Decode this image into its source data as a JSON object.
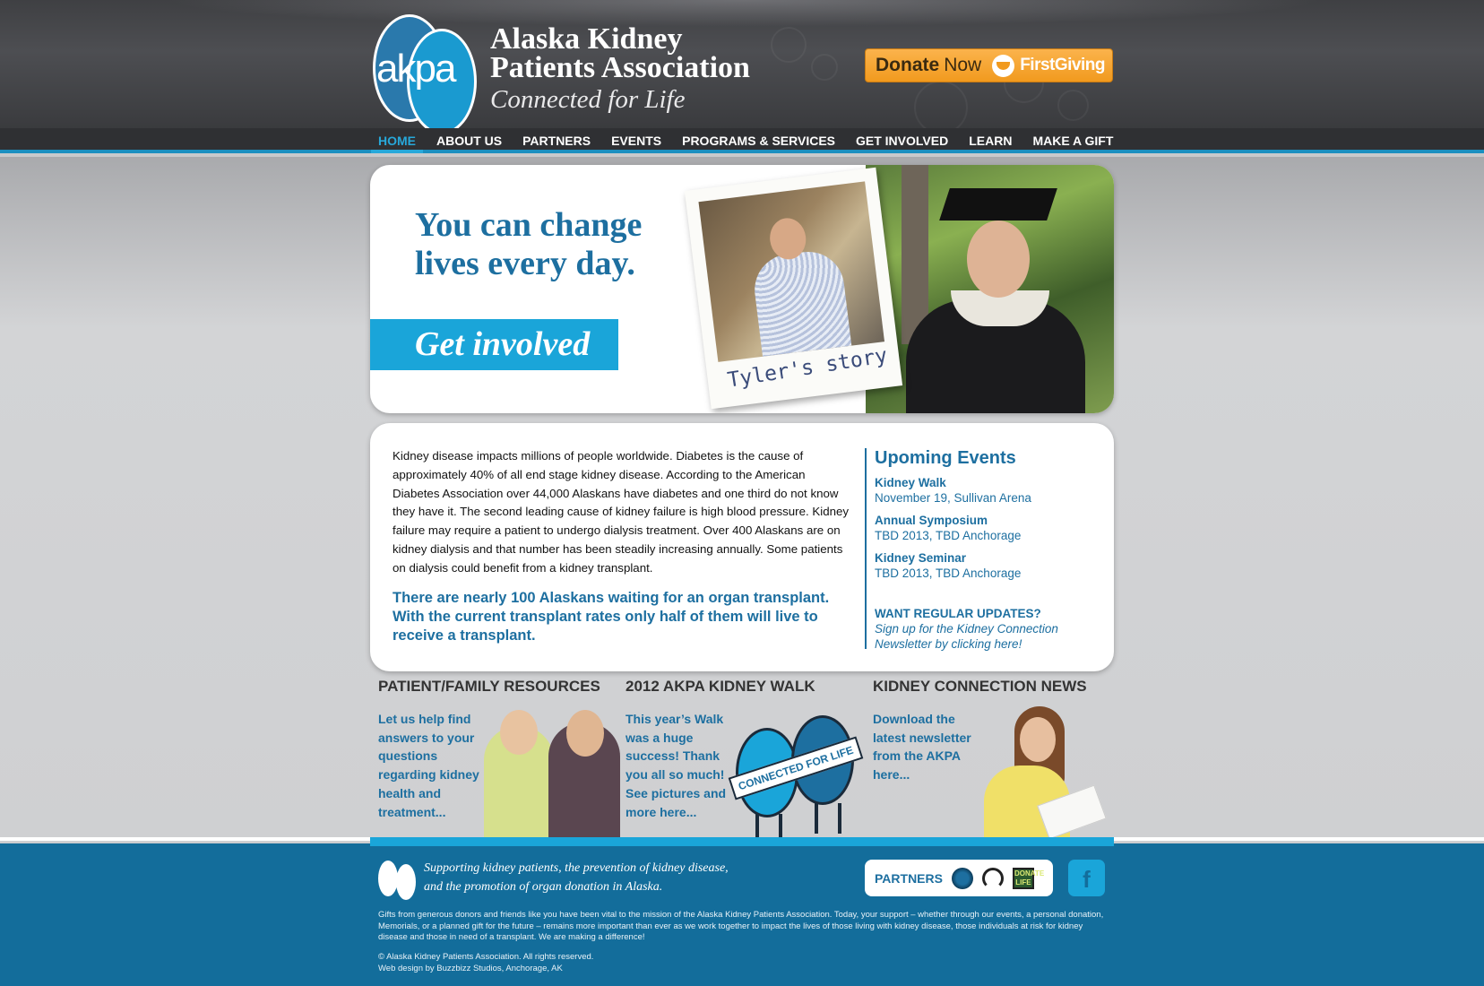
{
  "header": {
    "logo_text": "akpa",
    "site_name_line1": "Alaska Kidney",
    "site_name_line2": "Patients Association",
    "tagline": "Connected for Life",
    "donate": {
      "label_bold": "Donate",
      "label_light": "Now",
      "provider": "FirstGiving"
    }
  },
  "nav": {
    "items": [
      {
        "label": "HOME",
        "active": true
      },
      {
        "label": "ABOUT US",
        "active": false
      },
      {
        "label": "PARTNERS",
        "active": false
      },
      {
        "label": "EVENTS",
        "active": false
      },
      {
        "label": "PROGRAMS & SERVICES",
        "active": false
      },
      {
        "label": "GET INVOLVED",
        "active": false
      },
      {
        "label": "LEARN",
        "active": false
      },
      {
        "label": "MAKE A GIFT",
        "active": false
      }
    ]
  },
  "hero": {
    "headline": "You can change lives every day.",
    "cta": "Get involved",
    "polaroid_caption": "Tyler's story"
  },
  "info": {
    "intro": "Kidney disease impacts millions of people worldwide. Diabetes is the cause of approximately 40% of all end stage kidney disease. According to the American Diabetes Association over 44,000 Alaskans have diabetes and one third do not know they have it. The second leading cause of kidney failure is high blood pressure. Kidney failure may require a patient to undergo dialysis treatment. Over 400 Alaskans are on kidney dialysis and that number has been steadily increasing annually. Some patients on dialysis could benefit from a kidney transplant.",
    "callout": "There are nearly 100 Alaskans waiting for an organ transplant. With the current transplant rates only half of them will live to receive a transplant.",
    "events": {
      "heading": "Upoming Events",
      "items": [
        {
          "title": "Kidney Walk",
          "detail": "November 19, Sullivan Arena"
        },
        {
          "title": "Annual Symposium",
          "detail": "TBD 2013, TBD Anchorage"
        },
        {
          "title": "Kidney Seminar",
          "detail": "TBD 2013, TBD Anchorage"
        }
      ],
      "updates_title": "WANT REGULAR UPDATES?",
      "updates_text": "Sign up for the Kidney Connection Newsletter by clicking here!"
    }
  },
  "features": [
    {
      "title": "PATIENT/FAMILY RESOURCES",
      "text": "Let us help find answers to your questions regarding kidney health and treatment..."
    },
    {
      "title": "2012 AKPA KIDNEY WALK",
      "text": "This year’s Walk was a huge success! Thank you all so much! See pictures and more here...",
      "banner": "CONNECTED FOR LIFE"
    },
    {
      "title": "KIDNEY CONNECTION NEWS",
      "text": "Download the latest newsletter from the AKPA here..."
    }
  ],
  "footer": {
    "mission_line1": "Supporting kidney patients, the prevention of kidney disease,",
    "mission_line2": "and the promotion of organ donation in Alaska.",
    "partners_label": "PARTNERS",
    "partner_logo3_text": "DONATE LIFE",
    "facebook_glyph": "f",
    "gifts": "Gifts from generous donors and friends like you have been vital to the mission of the Alaska Kidney Patients Association.  Today, your support – whether through our events, a personal donation, Memorials, or a planned gift for the future – remains more important than ever as we work together to impact the lives of those living with kidney disease, those individuals at risk for kidney disease and those in need of a transplant. We are making a difference!",
    "copyright": "© Alaska Kidney Patients Association. All rights reserved.",
    "credit": "Web design by Buzzbizz Studios, Anchorage, AK"
  }
}
